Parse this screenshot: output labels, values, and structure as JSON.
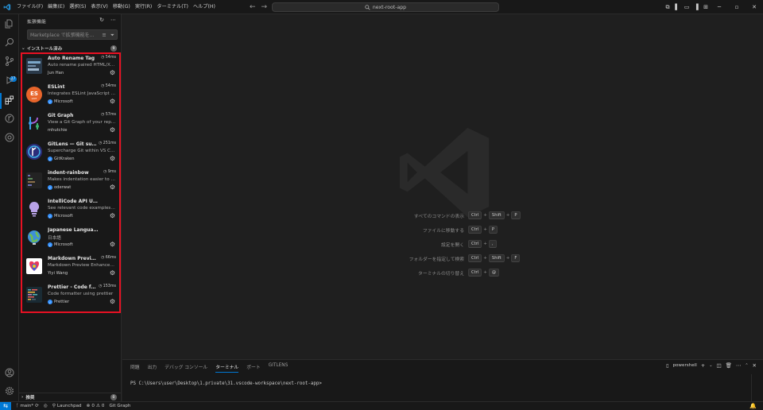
{
  "titlebar": {
    "menu": [
      "ファイル(F)",
      "編集(E)",
      "選択(S)",
      "表示(V)",
      "移動(G)",
      "実行(R)",
      "ターミナル(T)",
      "ヘルプ(H)"
    ],
    "search": "next-root-app",
    "nav_back": "←",
    "nav_forward": "→"
  },
  "sidebar": {
    "title": "拡張機能",
    "search_placeholder": "Marketplace で拡張機能を...",
    "installed_label": "インストール済み",
    "installed_count": "9",
    "recommended_label": "推奨",
    "recommended_count": "0",
    "extensions": [
      {
        "name": "Auto Rename Tag",
        "time": "54ms",
        "desc": "Auto rename paired HTML/XML tag",
        "publisher": "Jun Han",
        "verified": false,
        "icon": "auto-rename-tag-icon"
      },
      {
        "name": "ESLint",
        "time": "54ms",
        "desc": "Integrates ESLint JavaScript into VS Code.",
        "publisher": "Microsoft",
        "verified": true,
        "icon": "eslint-icon"
      },
      {
        "name": "Git Graph",
        "time": "57ms",
        "desc": "View a Git Graph of your repository",
        "publisher": "mhutchie",
        "verified": false,
        "icon": "git-graph-icon"
      },
      {
        "name": "GitLens — Git supercharged",
        "time": "251ms",
        "desc": "Supercharge Git within VS Code",
        "publisher": "GitKraken",
        "verified": true,
        "icon": "gitlens-icon"
      },
      {
        "name": "indent-rainbow",
        "time": "9ms",
        "desc": "Makes indentation easier to read",
        "publisher": "oderwat",
        "verified": true,
        "icon": "indent-rainbow-icon"
      },
      {
        "name": "IntelliCode API Usage Examples",
        "time": "",
        "desc": "See relevant code examples from GitHub",
        "publisher": "Microsoft",
        "verified": true,
        "icon": "intellicode-icon"
      },
      {
        "name": "Japanese Language Pack for VS Code",
        "time": "",
        "desc": "日本語",
        "publisher": "Microsoft",
        "verified": true,
        "icon": "japanese-language-pack-icon"
      },
      {
        "name": "Markdown Preview Enhanced",
        "time": "66ms",
        "desc": "Markdown Preview Enhanced ported to vscode",
        "publisher": "Yiyi Wang",
        "verified": false,
        "icon": "markdown-preview-icon"
      },
      {
        "name": "Prettier - Code formatter",
        "time": "153ms",
        "desc": "Code formatter using prettier",
        "publisher": "Prettier",
        "verified": true,
        "icon": "prettier-icon"
      }
    ]
  },
  "editor": {
    "shortcuts": [
      {
        "label": "すべてのコマンドの表示",
        "keys": [
          "Ctrl",
          "+",
          "Shift",
          "+",
          "P"
        ]
      },
      {
        "label": "ファイルに移動する",
        "keys": [
          "Ctrl",
          "+",
          "P"
        ]
      },
      {
        "label": "設定を開く",
        "keys": [
          "Ctrl",
          "+",
          ","
        ]
      },
      {
        "label": "フォルダーを指定して検索",
        "keys": [
          "Ctrl",
          "+",
          "Shift",
          "+",
          "F"
        ]
      },
      {
        "label": "ターミナルの切り替え",
        "keys": [
          "Ctrl",
          "+",
          "@"
        ]
      }
    ]
  },
  "panel": {
    "tabs": [
      "問題",
      "出力",
      "デバッグ コンソール",
      "ターミナル",
      "ポート",
      "GITLENS"
    ],
    "active_tab": "ターミナル",
    "shell_label": "powershell",
    "terminal_line": "PS C:\\Users\\user\\Desktop\\1.private\\31.vscode-workspace\\next-root-app>"
  },
  "statusbar": {
    "branch": "main*",
    "launchpad": "Launchpad",
    "errors": "0",
    "warnings": "0",
    "git_graph": "Git Graph"
  },
  "colors": {
    "accent": "#0078d4",
    "highlight_border": "#e81123",
    "background": "#1f1f1f",
    "sidebar": "#181818"
  }
}
